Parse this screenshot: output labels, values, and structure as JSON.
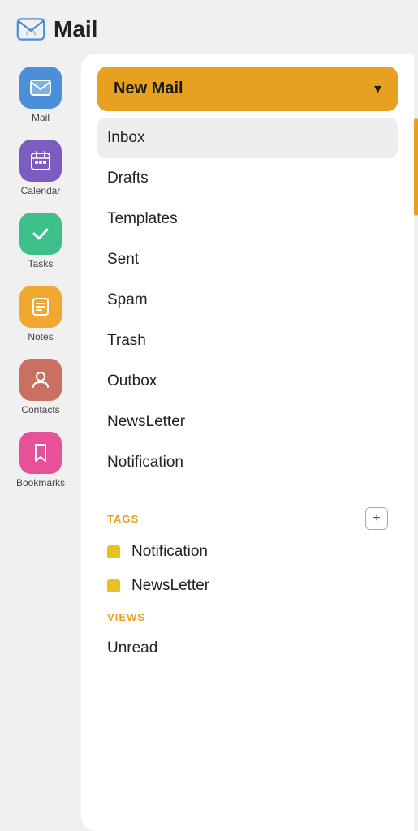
{
  "app": {
    "title": "Mail"
  },
  "header": {
    "title": "Mail",
    "icon_alt": "mail-app-icon"
  },
  "sidebar": {
    "items": [
      {
        "id": "mail",
        "label": "Mail",
        "color": "#4a90d9",
        "active": true
      },
      {
        "id": "calendar",
        "label": "Calendar",
        "color": "#7c5cbf"
      },
      {
        "id": "tasks",
        "label": "Tasks",
        "color": "#3dbf8a"
      },
      {
        "id": "notes",
        "label": "Notes",
        "color": "#f0a830"
      },
      {
        "id": "contacts",
        "label": "Contacts",
        "color": "#c97060"
      },
      {
        "id": "bookmarks",
        "label": "Bookmarks",
        "color": "#e8509a"
      }
    ]
  },
  "new_mail_button": {
    "label": "New Mail",
    "chevron": "▾"
  },
  "folders": [
    {
      "id": "inbox",
      "label": "Inbox",
      "active": true
    },
    {
      "id": "drafts",
      "label": "Drafts"
    },
    {
      "id": "templates",
      "label": "Templates"
    },
    {
      "id": "sent",
      "label": "Sent"
    },
    {
      "id": "spam",
      "label": "Spam"
    },
    {
      "id": "trash",
      "label": "Trash"
    },
    {
      "id": "outbox",
      "label": "Outbox"
    },
    {
      "id": "newsletter",
      "label": "NewsLetter"
    },
    {
      "id": "notification-folder",
      "label": "Notification"
    }
  ],
  "tags_section": {
    "title": "TAGS",
    "add_button_label": "+",
    "items": [
      {
        "id": "tag-notification",
        "label": "Notification",
        "color": "#e8c020"
      },
      {
        "id": "tag-newsletter",
        "label": "NewsLetter",
        "color": "#e8c020"
      }
    ]
  },
  "views_section": {
    "title": "VIEWS",
    "items": [
      {
        "id": "view-unread",
        "label": "Unread"
      }
    ]
  }
}
